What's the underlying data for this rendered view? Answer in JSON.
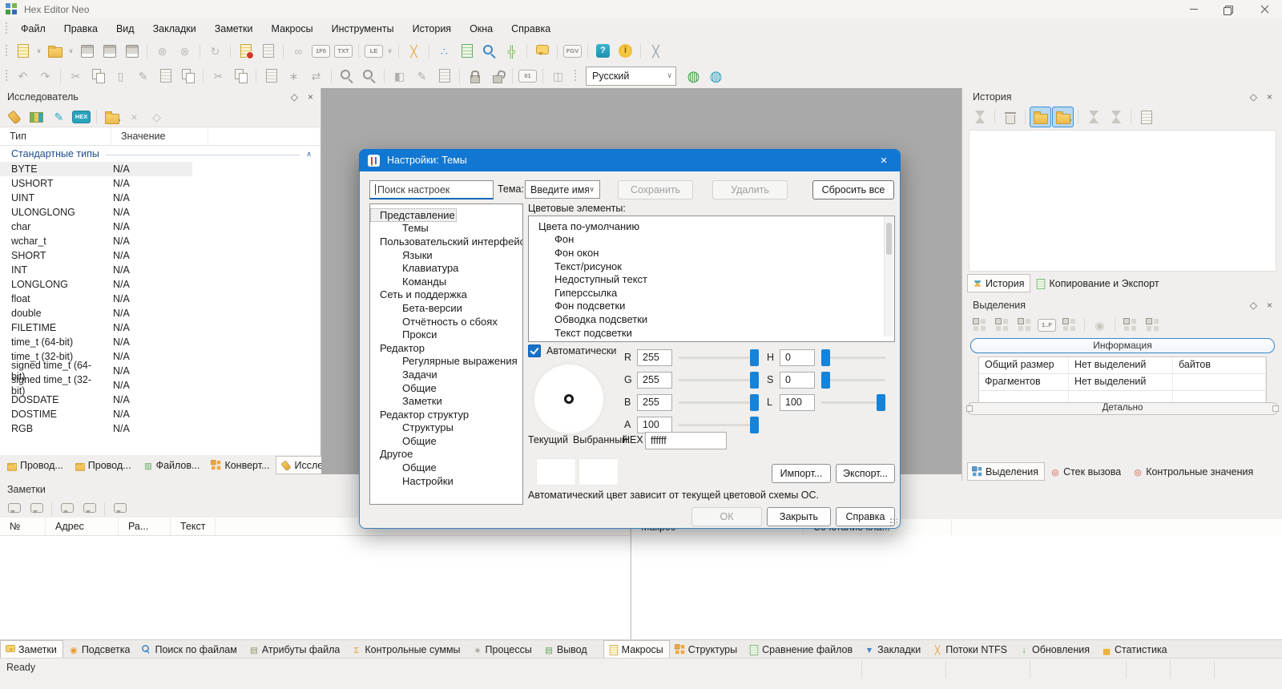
{
  "window": {
    "title": "Hex Editor Neo"
  },
  "icons": {
    "pin": "◇",
    "close": "×",
    "caret_down": "∨",
    "caret_up": "∧"
  },
  "menu": {
    "items": [
      "Файл",
      "Правка",
      "Вид",
      "Закладки",
      "Заметки",
      "Макросы",
      "Инструменты",
      "История",
      "Окна",
      "Справка"
    ]
  },
  "toolbar1": {
    "items": [
      {
        "name": "new-file-icon",
        "icls": "s-doc s-y"
      },
      {
        "name": "new-file-caret-icon",
        "cls": "caret",
        "glyph": "∨"
      },
      {
        "name": "open-file-icon",
        "icls": "s-folder"
      },
      {
        "name": "open-file-caret-icon",
        "cls": "caret",
        "glyph": "∨"
      },
      {
        "name": "save-icon",
        "icls": "s-disk"
      },
      {
        "name": "save-as-icon",
        "icls": "s-disk"
      },
      {
        "name": "save-all-icon",
        "icls": "s-disk"
      },
      {
        "cls": "sep"
      },
      {
        "name": "close-file-icon",
        "glyph": "⊗",
        "color": "#bcb8b2"
      },
      {
        "name": "close-all-icon",
        "glyph": "⊗",
        "color": "#bcb8b2"
      },
      {
        "cls": "sep"
      },
      {
        "name": "reload-icon",
        "glyph": "↻",
        "color": "#bcb8b2"
      },
      {
        "cls": "sep"
      },
      {
        "name": "record-macro-icon",
        "icls": "s-doc s-y s-dot"
      },
      {
        "name": "play-macro-icon",
        "icls": "s-doc s-gray"
      },
      {
        "cls": "sep"
      },
      {
        "name": "link-icon",
        "glyph": "∞",
        "color": "#bcb8b2"
      },
      {
        "name": "ifo-format-icon",
        "icls": "s-kbd",
        "glyph": "1F0"
      },
      {
        "name": "txt-format-icon",
        "icls": "s-kbd",
        "glyph": "TXT"
      },
      {
        "cls": "sep"
      },
      {
        "name": "endianness-icon",
        "icls": "s-kbd",
        "glyph": "LE"
      },
      {
        "name": "endianness-caret-icon",
        "cls": "caret",
        "glyph": "∨"
      },
      {
        "cls": "sep"
      },
      {
        "name": "arrange-windows-icon",
        "glyph": "╳",
        "color": "#e8a83c"
      },
      {
        "cls": "sep"
      },
      {
        "name": "share-icon",
        "glyph": "∴",
        "color": "#3399cc"
      },
      {
        "name": "compare-files-icon",
        "icls": "s-doc s-g"
      },
      {
        "name": "find-in-files-icon",
        "icls": "s-mag s-blue"
      },
      {
        "name": "plugins-icon",
        "glyph": "╬",
        "color": "#7ab648"
      },
      {
        "cls": "sep"
      },
      {
        "name": "comments-icon",
        "icls": "s-bubble s-y"
      },
      {
        "cls": "sep"
      },
      {
        "name": "shortcut-keys-icon",
        "icls": "s-kbd",
        "glyph": "FGV"
      },
      {
        "cls": "sep"
      },
      {
        "name": "help-icon",
        "icls": "s-badge s-teal",
        "glyph": "?"
      },
      {
        "name": "about-icon",
        "icls": "s-badge s-ycircle",
        "glyph": "i"
      },
      {
        "cls": "sep"
      },
      {
        "name": "tools-icon",
        "glyph": "╳",
        "color": "#8a9aa8"
      }
    ]
  },
  "toolbar2": {
    "items": [
      {
        "name": "undo-icon",
        "glyph": "↶",
        "color": "#b3b0ab"
      },
      {
        "name": "redo-icon",
        "glyph": "↷",
        "color": "#b3b0ab"
      },
      {
        "cls": "sep"
      },
      {
        "name": "cut-icon",
        "glyph": "✂",
        "color": "#b3b0ab"
      },
      {
        "name": "copy-icon",
        "icls": "s-copy"
      },
      {
        "name": "paste-icon",
        "glyph": "▯",
        "color": "#b3b0ab"
      },
      {
        "name": "edit-icon",
        "glyph": "✎",
        "color": "#b3b0ab"
      },
      {
        "name": "paste-special-icon",
        "icls": "s-doc s-gray"
      },
      {
        "name": "copy-special-icon",
        "icls": "s-copy"
      },
      {
        "cls": "sep"
      },
      {
        "name": "cut-append-icon",
        "glyph": "✂",
        "color": "#b3b0ab"
      },
      {
        "name": "copy-append-icon",
        "icls": "s-copy"
      },
      {
        "cls": "sep"
      },
      {
        "name": "insert-file-icon",
        "icls": "s-doc s-gray"
      },
      {
        "name": "modify-bits-icon",
        "glyph": "∗",
        "color": "#b3b0ab"
      },
      {
        "name": "swap-bytes-icon",
        "glyph": "⇄",
        "color": "#b3b0ab"
      },
      {
        "cls": "sep"
      },
      {
        "name": "find-icon",
        "icls": "s-mag"
      },
      {
        "name": "replace-icon",
        "icls": "s-mag"
      },
      {
        "cls": "sep"
      },
      {
        "name": "fill-icon",
        "glyph": "◧",
        "color": "#b3b0ab"
      },
      {
        "name": "edit-selection-icon",
        "glyph": "✎",
        "color": "#b3b0ab"
      },
      {
        "name": "insert-bytes-icon",
        "icls": "s-doc s-gray"
      },
      {
        "cls": "sep"
      },
      {
        "name": "lock-icon",
        "icls": "s-lock"
      },
      {
        "name": "unlock-icon",
        "icls": "s-lock s-unlock"
      },
      {
        "cls": "sep"
      },
      {
        "name": "binary-view-icon",
        "icls": "s-kbd",
        "glyph": "01"
      },
      {
        "cls": "sep"
      },
      {
        "name": "column-mode-icon",
        "glyph": "◫",
        "color": "#b3b0ab"
      }
    ],
    "language": "Русский",
    "trailing": [
      {
        "name": "add-language-icon",
        "glyph": "◍",
        "color": "#3f9e49"
      },
      {
        "name": "language-settings-icon",
        "glyph": "◍",
        "color": "#2a9fc0"
      }
    ]
  },
  "explorer": {
    "title": "Исследователь",
    "toolbar": [
      {
        "name": "flashlight-icon",
        "icls": "s-torch"
      },
      {
        "name": "palette-icon",
        "icls": "s-palette"
      },
      {
        "name": "pencil-icon",
        "glyph": "✎",
        "color": "#2aa7c7"
      },
      {
        "name": "hex-view-icon",
        "icls": "s-kbd s-teal",
        "glyph": "HEX"
      },
      {
        "cls": "sep"
      },
      {
        "name": "add-type-icon",
        "icls": "s-folder s-plus"
      },
      {
        "name": "remove-type-icon",
        "glyph": "×",
        "color": "#bcb8b2"
      },
      {
        "name": "pin-type-icon",
        "glyph": "◇",
        "color": "#bcb8b2"
      }
    ],
    "columns": [
      "Тип",
      "Значение"
    ],
    "group": "Стандартные типы",
    "rows": [
      {
        "type": "BYTE",
        "value": "N/A",
        "selected": true
      },
      {
        "type": "USHORT",
        "value": "N/A"
      },
      {
        "type": "UINT",
        "value": "N/A"
      },
      {
        "type": "ULONGLONG",
        "value": "N/A"
      },
      {
        "type": "char",
        "value": "N/A"
      },
      {
        "type": "wchar_t",
        "value": "N/A"
      },
      {
        "type": "SHORT",
        "value": "N/A"
      },
      {
        "type": "INT",
        "value": "N/A"
      },
      {
        "type": "LONGLONG",
        "value": "N/A"
      },
      {
        "type": "float",
        "value": "N/A"
      },
      {
        "type": "double",
        "value": "N/A"
      },
      {
        "type": "FILETIME",
        "value": "N/A"
      },
      {
        "type": "time_t (64-bit)",
        "value": "N/A"
      },
      {
        "type": "time_t (32-bit)",
        "value": "N/A"
      },
      {
        "type": "signed time_t (64-bit)",
        "value": "N/A"
      },
      {
        "type": "signed time_t (32-bit)",
        "value": "N/A"
      },
      {
        "type": "DOSDATE",
        "value": "N/A"
      },
      {
        "type": "DOSTIME",
        "value": "N/A"
      },
      {
        "type": "RGB",
        "value": "N/A"
      }
    ],
    "tabs": [
      {
        "label": "Провод...",
        "icls": "s-folder"
      },
      {
        "label": "Провод...",
        "icls": "s-folder"
      },
      {
        "label": "Файлов...",
        "glyph": "▥",
        "color": "#5aa85a"
      },
      {
        "label": "Конверт...",
        "icls": "s-grid s-or"
      },
      {
        "label": "Исследо...",
        "icls": "s-torch",
        "active": true
      }
    ]
  },
  "history": {
    "title": "История",
    "toolbar": [
      {
        "name": "history-tree-icon",
        "icls": "s-hg"
      },
      {
        "cls": "sep"
      },
      {
        "name": "clear-history-icon",
        "icls": "s-trash"
      },
      {
        "cls": "sep"
      },
      {
        "name": "keep-history-icon",
        "icls": "s-folder",
        "cls": "active"
      },
      {
        "name": "keep-history-new-icon",
        "icls": "s-folder s-plus",
        "cls": "active"
      },
      {
        "cls": "sep"
      },
      {
        "name": "history-undo-icon",
        "icls": "s-hg"
      },
      {
        "name": "history-redo-icon",
        "icls": "s-hg"
      },
      {
        "cls": "sep"
      },
      {
        "name": "export-history-icon",
        "icls": "s-doc s-gray"
      }
    ],
    "tabs": [
      {
        "label": "История",
        "icls": "s-hg s-col",
        "active": true
      },
      {
        "label": "Копирование и Экспорт",
        "icls": "s-doc s-g"
      }
    ]
  },
  "selections": {
    "title": "Выделения",
    "toolbar": [
      {
        "name": "select-all-icon",
        "icls": "s-grid"
      },
      {
        "name": "select-none-icon",
        "icls": "s-grid"
      },
      {
        "name": "invert-selection-icon",
        "icls": "s-grid"
      },
      {
        "name": "select-range-icon",
        "icls": "s-kbd",
        "glyph": "1..F"
      },
      {
        "name": "select-block-icon",
        "icls": "s-grid"
      },
      {
        "cls": "sep"
      },
      {
        "name": "hand-select-icon",
        "glyph": "◉",
        "color": "#c9c5bf"
      },
      {
        "cls": "sep"
      },
      {
        "name": "save-selection-icon",
        "icls": "s-grid"
      },
      {
        "name": "load-selection-icon",
        "icls": "s-grid"
      }
    ],
    "info_header": "Информация",
    "info_rows": [
      [
        "Общий размер",
        "Нет выделений",
        "байтов"
      ],
      [
        "Фрагментов",
        "Нет выделений",
        ""
      ],
      [
        "",
        "",
        ""
      ]
    ],
    "details_label": "Детально",
    "tabs": [
      {
        "label": "Выделения",
        "icls": "s-grid s-blue",
        "active": true
      },
      {
        "label": "Стек вызова",
        "glyph": "◎",
        "color": "#d04a3a"
      },
      {
        "label": "Контрольные значения",
        "glyph": "◎",
        "color": "#d04a3a"
      }
    ]
  },
  "notes": {
    "title": "Заметки",
    "toolbar": [
      {
        "name": "add-note-icon",
        "icls": "s-bubble s-gray"
      },
      {
        "name": "remove-note-icon",
        "icls": "s-bubble s-gray"
      },
      {
        "cls": "sep"
      },
      {
        "name": "show-notes-icon",
        "icls": "s-bubble s-gray"
      },
      {
        "name": "edit-note-icon",
        "icls": "s-bubble s-gray"
      },
      {
        "cls": "sep"
      },
      {
        "name": "delete-notes-icon",
        "icls": "s-bubble s-gray"
      }
    ],
    "columns": [
      "№",
      "Адрес",
      "Ра...",
      "Текст"
    ],
    "tabs": [
      {
        "label": "Заметки",
        "icls": "s-bubble s-y",
        "active": true
      },
      {
        "label": "Подсветка",
        "glyph": "◉",
        "color": "#e8972e"
      },
      {
        "label": "Поиск по файлам",
        "icls": "s-mag s-blue"
      },
      {
        "label": "Атрибуты файла",
        "glyph": "▤",
        "color": "#8a9a6a"
      },
      {
        "label": "Контрольные суммы",
        "glyph": "Σ",
        "color": "#e8972e"
      },
      {
        "label": "Процессы",
        "glyph": "∗",
        "color": "#9a958d"
      },
      {
        "label": "Вывод",
        "glyph": "▤",
        "color": "#5aa85a"
      }
    ]
  },
  "macros_panel": {
    "columns": [
      "Макрос",
      "Сочетание кла..."
    ],
    "tabs": [
      {
        "label": "Макросы",
        "icls": "s-doc s-y",
        "active": true
      },
      {
        "label": "Структуры",
        "icls": "s-grid s-or"
      },
      {
        "label": "Сравнение файлов",
        "icls": "s-doc s-g"
      },
      {
        "label": "Закладки",
        "glyph": "▼",
        "color": "#3a87c8"
      },
      {
        "label": "Потоки NTFS",
        "glyph": "╳",
        "color": "#e8972e"
      },
      {
        "label": "Обновления",
        "glyph": "↓",
        "color": "#4a9e4a"
      },
      {
        "label": "Статистика",
        "glyph": "▅",
        "color": "#e8b23c"
      }
    ]
  },
  "statusbar": {
    "text": "Ready"
  },
  "dialog": {
    "title": "Настройки: Темы",
    "accent": "#1277d3",
    "search_placeholder": "Поиск настроек",
    "theme_label": "Тема:",
    "theme_combo_value": "Введите имя схемы",
    "buttons": {
      "save": "Сохранить",
      "delete": "Удалить",
      "reset": "Сбросить все",
      "import": "Импорт...",
      "export": "Экспорт...",
      "ok": "ОК",
      "close": "Закрыть",
      "help": "Справка"
    },
    "tree": [
      {
        "label": "Представление",
        "level": 0,
        "selected": true
      },
      {
        "label": "Темы",
        "level": 1
      },
      {
        "label": "Пользовательский интерфейс",
        "level": 0
      },
      {
        "label": "Языки",
        "level": 1
      },
      {
        "label": "Клавиатура",
        "level": 1
      },
      {
        "label": "Команды",
        "level": 1
      },
      {
        "label": "Сеть и поддержка",
        "level": 0
      },
      {
        "label": "Бета-версии",
        "level": 1
      },
      {
        "label": "Отчётность о сбоях",
        "level": 1
      },
      {
        "label": "Прокси",
        "level": 1
      },
      {
        "label": "Редактор",
        "level": 0
      },
      {
        "label": "Регулярные выражения",
        "level": 1
      },
      {
        "label": "Задачи",
        "level": 1
      },
      {
        "label": "Общие",
        "level": 1
      },
      {
        "label": "Заметки",
        "level": 1
      },
      {
        "label": "Редактор структур",
        "level": 0
      },
      {
        "label": "Структуры",
        "level": 1
      },
      {
        "label": "Общие",
        "level": 1
      },
      {
        "label": "Другое",
        "level": 0
      },
      {
        "label": "Общие",
        "level": 1
      },
      {
        "label": "Настройки",
        "level": 1
      }
    ],
    "color_elements_label": "Цветовые элементы:",
    "color_tree": [
      {
        "label": "Цвета по-умолчанию",
        "level": 0
      },
      {
        "label": "Фон",
        "level": 1
      },
      {
        "label": "Фон окон",
        "level": 1
      },
      {
        "label": "Текст/рисунок",
        "level": 1
      },
      {
        "label": "Недоступный текст",
        "level": 1
      },
      {
        "label": "Гиперссылка",
        "level": 1
      },
      {
        "label": "Фон подсветки",
        "level": 1
      },
      {
        "label": "Обводка подсветки",
        "level": 1
      },
      {
        "label": "Текст подсветки",
        "level": 1
      }
    ],
    "auto_checkbox_label": "Автоматически",
    "channels": [
      {
        "label": "R",
        "value": "255",
        "thumb": "right"
      },
      {
        "label": "G",
        "value": "255",
        "thumb": "right"
      },
      {
        "label": "B",
        "value": "255",
        "thumb": "right"
      },
      {
        "label": "A",
        "value": "100",
        "thumb": "right"
      }
    ],
    "hsl": [
      {
        "label": "H",
        "value": "0",
        "thumb": "left"
      },
      {
        "label": "S",
        "value": "0",
        "thumb": "left"
      },
      {
        "label": "L",
        "value": "100",
        "thumb": "right"
      }
    ],
    "current_label": "Текущий",
    "selected_label": "Выбранный:",
    "hex_label": "HEX",
    "hex_value": "ffffff",
    "note": "Автоматический цвет зависит от текущей цветовой схемы ОС."
  }
}
